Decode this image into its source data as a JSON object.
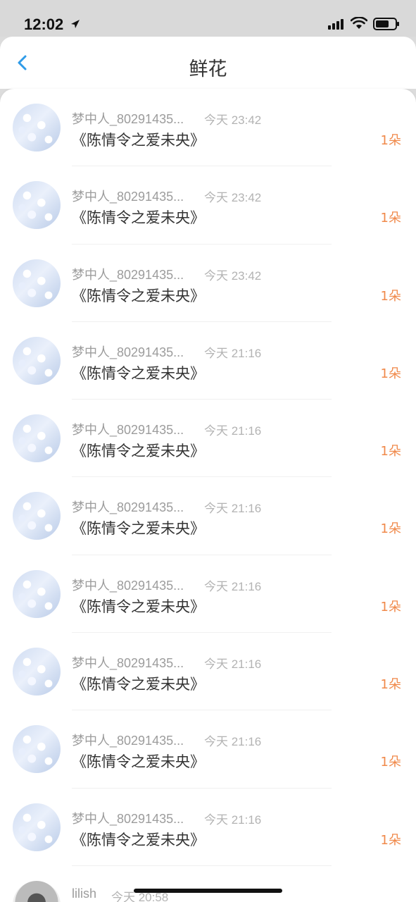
{
  "status_bar": {
    "time": "12:02"
  },
  "nav": {
    "title": "鲜花"
  },
  "rows": [
    {
      "user": "梦中人_80291435...",
      "time": "今天 23:42",
      "title": "《陈情令之爱未央》",
      "count": "1朵"
    },
    {
      "user": "梦中人_80291435...",
      "time": "今天 23:42",
      "title": "《陈情令之爱未央》",
      "count": "1朵"
    },
    {
      "user": "梦中人_80291435...",
      "time": "今天 23:42",
      "title": "《陈情令之爱未央》",
      "count": "1朵"
    },
    {
      "user": "梦中人_80291435...",
      "time": "今天 21:16",
      "title": "《陈情令之爱未央》",
      "count": "1朵"
    },
    {
      "user": "梦中人_80291435...",
      "time": "今天 21:16",
      "title": "《陈情令之爱未央》",
      "count": "1朵"
    },
    {
      "user": "梦中人_80291435...",
      "time": "今天 21:16",
      "title": "《陈情令之爱未央》",
      "count": "1朵"
    },
    {
      "user": "梦中人_80291435...",
      "time": "今天 21:16",
      "title": "《陈情令之爱未央》",
      "count": "1朵"
    },
    {
      "user": "梦中人_80291435...",
      "time": "今天 21:16",
      "title": "《陈情令之爱未央》",
      "count": "1朵"
    },
    {
      "user": "梦中人_80291435...",
      "time": "今天 21:16",
      "title": "《陈情令之爱未央》",
      "count": "1朵"
    },
    {
      "user": "梦中人_80291435...",
      "time": "今天 21:16",
      "title": "《陈情令之爱未央》",
      "count": "1朵"
    },
    {
      "user": "lilish",
      "time": "今天 20:58",
      "title": "",
      "count": ""
    }
  ],
  "colors": {
    "accent": "#f0894a",
    "back_icon": "#2f9be8"
  }
}
